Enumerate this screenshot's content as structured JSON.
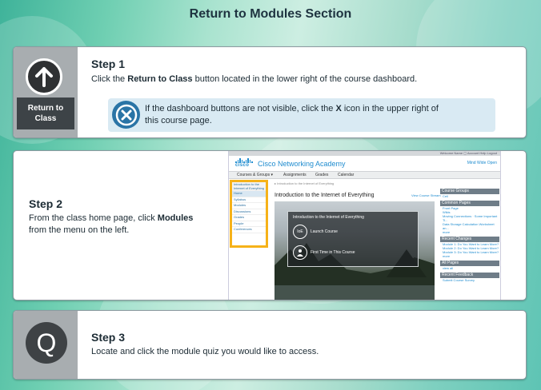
{
  "page_title": "Return to Modules Section",
  "step1": {
    "title": "Step 1",
    "text_prefix": "Click the ",
    "text_bold": "Return to Class",
    "text_suffix": " button located in the lower right of the course dashboard.",
    "icon": "up-arrow-icon",
    "button_line1": "Return to",
    "button_line2": "Class",
    "note": {
      "icon": "close-x-icon",
      "line1_prefix": "If the dashboard buttons are not visible, click the ",
      "line1_bold": "X",
      "line1_suffix": " icon in the upper right of",
      "line2": "this course page."
    }
  },
  "step2": {
    "title": "Step 2",
    "line1_prefix": "From the class home page, click ",
    "line1_bold": "Modules",
    "line2": "from the menu on the left.",
    "screenshot": {
      "top_links": "Welcome Name  ▢  Account  Help  Logout",
      "logo_word": "cisco",
      "app_name": "Cisco Networking Academy",
      "user_link": "Mind Wide Open",
      "nav": [
        "Courses & Groups ▾",
        "Assignments",
        "Grades",
        "Calendar"
      ],
      "menu_header": "Introduction to the Internet of Everything",
      "menu_items": [
        "Home",
        "Syllabus",
        "Modules",
        "Discussions",
        "Grades",
        "People",
        "Conferences"
      ],
      "breadcrumb": "▸ Introduction to the Internet of Everything",
      "course_title": "Introduction to the Internet of Everything",
      "course_stream": "View Course Stream",
      "hero_title": "Introduction to the Internet of Everything",
      "launch_icon": "IoE",
      "launch_label": "Launch Course",
      "first_time_label": "First Time in This Course",
      "right_sections": [
        {
          "header": "Course Groups",
          "items": [
            "Cell"
          ]
        },
        {
          "header": "Common Pages",
          "items": [
            "Front Page",
            "Wikis",
            "Moving Connections · Some Important Ti...",
            "Data Storage Calculation Worksheet an...",
            "more"
          ]
        },
        {
          "header": "Recent Changes",
          "items": [
            "Module 1: Do You Want to Learn More?",
            "Module 2: Do You Want to Learn More?",
            "Module 3: Do You Want to Learn More?",
            "more"
          ]
        },
        {
          "header": "All Pages",
          "items": [
            "view all"
          ]
        },
        {
          "header": "Recent Feedback",
          "items": [
            "Submit Course Survey"
          ]
        }
      ]
    }
  },
  "step3": {
    "title": "Step 3",
    "text": "Locate and click the module quiz you would like to access.",
    "icon_letter": "Q"
  },
  "colors": {
    "accent_blue": "#2a74a6",
    "highlight_orange": "#f6b219",
    "sidebar_gray": "#a8adb0"
  }
}
